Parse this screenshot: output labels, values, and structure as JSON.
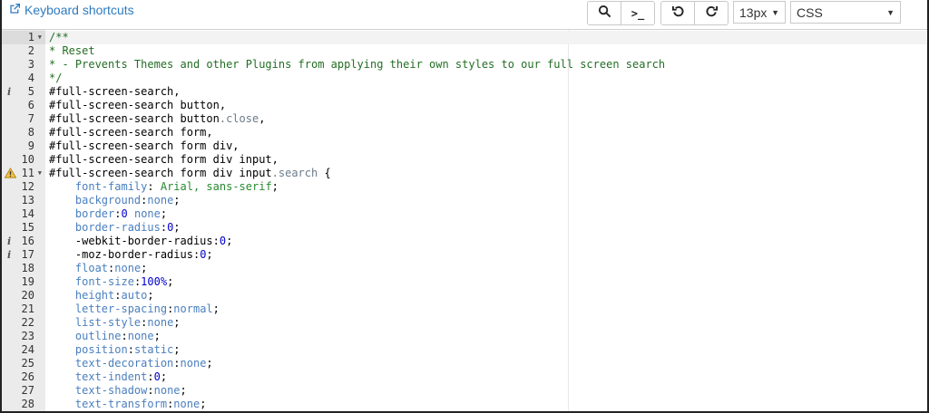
{
  "toolbar": {
    "keyboard_shortcuts": "Keyboard shortcuts",
    "search_icon": "search-icon",
    "cli_label": ">_",
    "undo_icon": "undo-icon",
    "redo_icon": "redo-icon",
    "font_size": "13px",
    "mode": "CSS",
    "link_color": "#2e7bbf"
  },
  "editor": {
    "active_line": 1,
    "lines": [
      {
        "n": "1",
        "fold": true,
        "text": "/**"
      },
      {
        "n": "2",
        "text": "* Reset"
      },
      {
        "n": "3",
        "text": "* - Prevents Themes and other Plugins from applying their own styles to our full screen search"
      },
      {
        "n": "4",
        "text": "*/"
      },
      {
        "n": "5",
        "mark": "info",
        "text": "#full-screen-search,"
      },
      {
        "n": "6",
        "text": "#full-screen-search button,"
      },
      {
        "n": "7",
        "text": "#full-screen-search button.close,"
      },
      {
        "n": "8",
        "text": "#full-screen-search form,"
      },
      {
        "n": "9",
        "text": "#full-screen-search form div,"
      },
      {
        "n": "10",
        "text": "#full-screen-search form div input,"
      },
      {
        "n": "11",
        "mark": "warning",
        "fold": true,
        "text": "#full-screen-search form div input.search {"
      },
      {
        "n": "12",
        "text": "    font-family: Arial, sans-serif;"
      },
      {
        "n": "13",
        "text": "    background:none;"
      },
      {
        "n": "14",
        "text": "    border:0 none;"
      },
      {
        "n": "15",
        "text": "    border-radius:0;"
      },
      {
        "n": "16",
        "mark": "info",
        "text": "    -webkit-border-radius:0;"
      },
      {
        "n": "17",
        "mark": "info",
        "text": "    -moz-border-radius:0;"
      },
      {
        "n": "18",
        "text": "    float:none;"
      },
      {
        "n": "19",
        "text": "    font-size:100%;"
      },
      {
        "n": "20",
        "text": "    height:auto;"
      },
      {
        "n": "21",
        "text": "    letter-spacing:normal;"
      },
      {
        "n": "22",
        "text": "    list-style:none;"
      },
      {
        "n": "23",
        "text": "    outline:none;"
      },
      {
        "n": "24",
        "text": "    position:static;"
      },
      {
        "n": "25",
        "text": "    text-decoration:none;"
      },
      {
        "n": "26",
        "text": "    text-indent:0;"
      },
      {
        "n": "27",
        "text": "    text-shadow:none;"
      },
      {
        "n": "28",
        "text": "    text-transform:none;"
      }
    ]
  }
}
